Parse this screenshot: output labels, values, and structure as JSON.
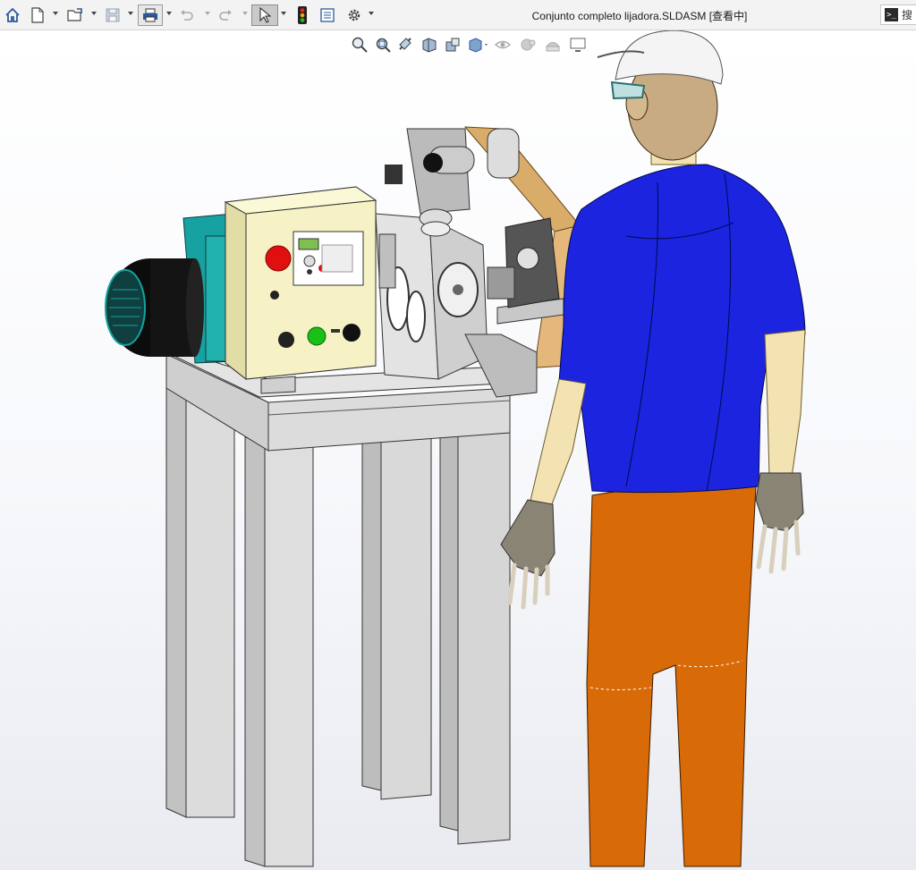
{
  "window": {
    "title": "Conjunto completo lijadora.SLDASM [查看中]",
    "search_placeholder": "搜"
  },
  "toolbar": {
    "items": [
      {
        "name": "home-icon",
        "interactable": true
      },
      {
        "name": "new-document-icon",
        "interactable": true
      },
      {
        "name": "open-file-icon",
        "interactable": true
      },
      {
        "name": "save-icon",
        "interactable": true
      },
      {
        "name": "print-icon",
        "interactable": true
      },
      {
        "name": "undo-icon",
        "interactable": true
      },
      {
        "name": "redo-icon",
        "interactable": true
      },
      {
        "name": "select-pointer-icon",
        "interactable": true
      },
      {
        "name": "traffic-light-icon",
        "interactable": true
      },
      {
        "name": "file-properties-icon",
        "interactable": true
      },
      {
        "name": "options-gear-icon",
        "interactable": true
      }
    ]
  },
  "heads_up_toolbar": {
    "items": [
      "zoom-to-fit-icon",
      "zoom-to-area-icon",
      "previous-view-icon",
      "section-view-icon",
      "dynamic-annotation-icon",
      "view-orientation-icon",
      "display-style-icon",
      "hide-show-items-icon",
      "edit-appearance-icon",
      "apply-scene-icon",
      "view-settings-icon"
    ]
  },
  "colors": {
    "toolbar_bg": "#f3f3f3",
    "shirt": "#1c24e0",
    "pants": "#d86a08",
    "skin": "#f3e3b3",
    "helmet": "#f4f4f4",
    "control_box": "#f5f0c0",
    "motor": "#0d0d0d",
    "motor_housing": "#1aa0a0",
    "table_frame": "#d4d4d4",
    "belt": "#d9ac6a",
    "stop_button": "#e01010",
    "start_button": "#18c018"
  },
  "viewport": {
    "scene_description_icon": "sander-assembly-with-operator-3d-model"
  }
}
